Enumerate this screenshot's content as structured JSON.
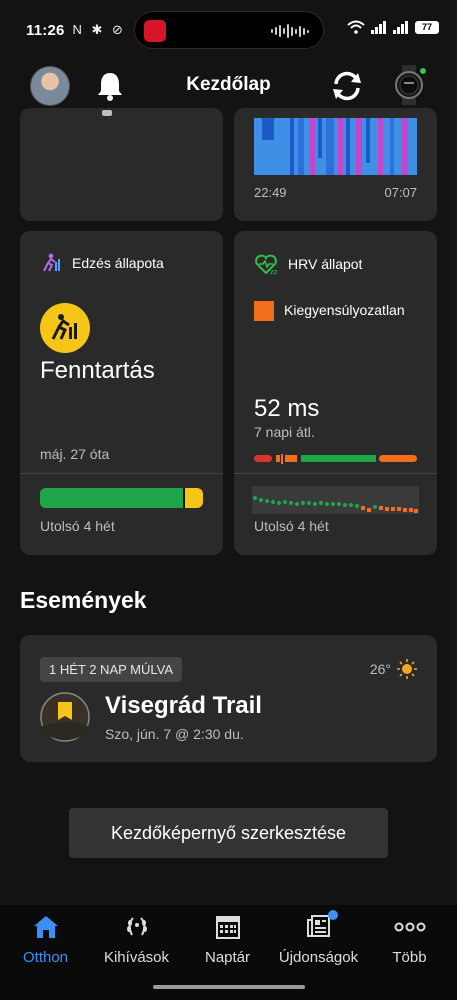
{
  "status_bar": {
    "time": "11:26",
    "left_icons": "N ✱ ⊘",
    "battery": "77"
  },
  "header": {
    "title": "Kezdőlap"
  },
  "sleep_card": {
    "start_time": "22:49",
    "end_time": "07:07"
  },
  "training_card": {
    "title": "Edzés állapota",
    "status": "Fenntartás",
    "since": "máj. 27 óta",
    "footer": "Utolsó 4 hét",
    "bar_fill_fraction": 0.88,
    "colors": {
      "green": "#1fa64a",
      "yellow": "#f5c518"
    }
  },
  "hrv_card": {
    "title": "HRV állapot",
    "status": "Kiegyensúlyozatlan",
    "value": "52 ms",
    "sub": "7 napi átl.",
    "footer": "Utolsó 4 hét",
    "colors": {
      "orange": "#f26d1c",
      "green": "#1fa64a",
      "red": "#d9342b"
    }
  },
  "events": {
    "heading": "Események",
    "badge": "1 HÉT 2 NAP MÚLVA",
    "weather": "26°",
    "event_title": "Visegrád Trail",
    "event_time": "Szo, jún. 7 @ 2:30 du."
  },
  "edit_button": "Kezdőképernyő szerkesztése",
  "bottom_nav": [
    {
      "label": "Otthon",
      "icon": "home-icon"
    },
    {
      "label": "Kihívások",
      "icon": "laurel-icon"
    },
    {
      "label": "Naptár",
      "icon": "calendar-icon"
    },
    {
      "label": "Újdonságok",
      "icon": "news-icon"
    },
    {
      "label": "Több",
      "icon": "more-icon"
    }
  ],
  "accent_color": "#3b8ff5"
}
